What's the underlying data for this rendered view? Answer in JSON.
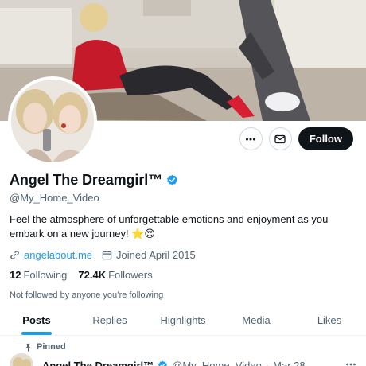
{
  "profile": {
    "display_name": "Angel The Dreamgirl™",
    "handle": "@My_Home_Video",
    "bio": "Feel the atmosphere of unforgettable emotions and enjoyment as you embark on a new journey! ⭐😍",
    "website": "angelabout.me",
    "joined": "Joined April 2015",
    "following_count": "12",
    "following_label": "Following",
    "followers_count": "72.4K",
    "followers_label": "Followers",
    "not_followed_note": "Not followed by anyone you’re following",
    "verified_color": "#1d9bf0"
  },
  "actions": {
    "more_icon": "more-horizontal-icon",
    "message_icon": "envelope-icon",
    "follow_label": "Follow"
  },
  "tabs": [
    {
      "label": "Posts"
    },
    {
      "label": "Replies"
    },
    {
      "label": "Highlights"
    },
    {
      "label": "Media"
    },
    {
      "label": "Likes"
    }
  ],
  "pinned_post": {
    "pinned_label": "Pinned",
    "author": "Angel The Dreamgirl™",
    "handle": "@My_Home_Video",
    "separator": "·",
    "date": "Mar 28"
  },
  "colors": {
    "accent": "#1d9bf0",
    "text": "#0f1419",
    "muted": "#536471",
    "follow_bg": "#0f1419"
  }
}
